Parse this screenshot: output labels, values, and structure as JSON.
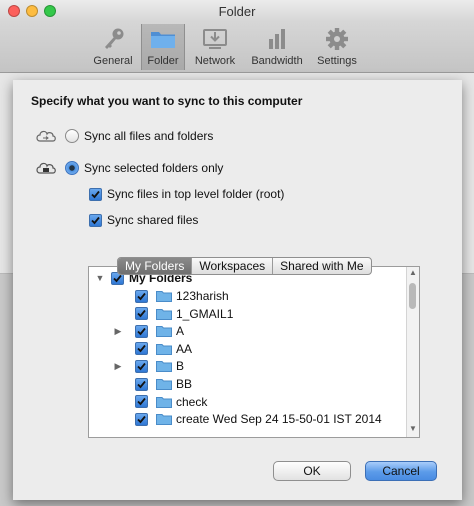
{
  "window": {
    "title": "Folder"
  },
  "toolbar": {
    "items": [
      {
        "label": "General",
        "icon": "key-icon",
        "active": false
      },
      {
        "label": "Folder",
        "icon": "folder-icon",
        "active": true
      },
      {
        "label": "Network",
        "icon": "network-download-icon",
        "active": false
      },
      {
        "label": "Bandwidth",
        "icon": "bar-chart-icon",
        "active": false
      },
      {
        "label": "Settings",
        "icon": "gear-icon",
        "active": false
      }
    ]
  },
  "sheet": {
    "heading": "Specify what you want to sync to this computer",
    "sync_all_label": "Sync all files and folders",
    "sync_selected_label": "Sync selected folders only",
    "sync_selected_checked": true,
    "sync_root_label": "Sync files in top level folder (root)",
    "sync_shared_label": "Sync shared files"
  },
  "tabs": [
    {
      "label": "My Folders",
      "active": true
    },
    {
      "label": "Workspaces",
      "active": false
    },
    {
      "label": "Shared with Me",
      "active": false
    }
  ],
  "tree": {
    "root_label": "My Folders",
    "items": [
      {
        "label": "123harish",
        "expandable": false
      },
      {
        "label": "1_GMAIL1",
        "expandable": false
      },
      {
        "label": "A",
        "expandable": true
      },
      {
        "label": "AA",
        "expandable": false
      },
      {
        "label": "B",
        "expandable": true
      },
      {
        "label": "BB",
        "expandable": false
      },
      {
        "label": "check",
        "expandable": false
      },
      {
        "label": "create Wed Sep 24 15-50-01 IST 2014",
        "expandable": false
      }
    ]
  },
  "buttons": {
    "ok": "OK",
    "cancel": "Cancel"
  },
  "colors": {
    "accent": "#4a8ce2",
    "folder": "#6fb3e8"
  }
}
